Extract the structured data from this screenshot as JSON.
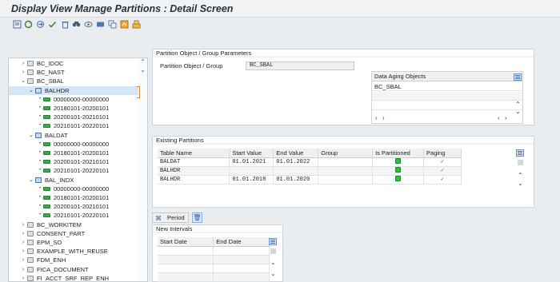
{
  "window": {
    "title": "Display View Manage Partitions : Detail Screen"
  },
  "toolbar": {
    "icons": [
      "display-object-icon",
      "refresh-icon",
      "transport-icon",
      "check-icon",
      "delete-icon",
      "find-icon",
      "display-icon",
      "info-icon",
      "copy-icon",
      "execute-icon",
      "org-icon"
    ]
  },
  "tree": {
    "items": [
      {
        "label": "BC_IDOC",
        "level": 1,
        "type": "node",
        "expanded": false
      },
      {
        "label": "BC_NAST",
        "level": 1,
        "type": "node",
        "expanded": false
      },
      {
        "label": "BC_SBAL",
        "level": 1,
        "type": "node",
        "expanded": true
      },
      {
        "label": "BALHDR",
        "level": 2,
        "type": "table",
        "expanded": true,
        "selected": true
      },
      {
        "label": "00000000-00000000",
        "level": 3,
        "type": "leaf"
      },
      {
        "label": "20180101-20200101",
        "level": 3,
        "type": "leaf"
      },
      {
        "label": "20200101-20210101",
        "level": 3,
        "type": "leaf"
      },
      {
        "label": "20210101-20220101",
        "level": 3,
        "type": "leaf"
      },
      {
        "label": "BALDAT",
        "level": 2,
        "type": "table",
        "expanded": true
      },
      {
        "label": "00000000-00000000",
        "level": 3,
        "type": "leaf"
      },
      {
        "label": "20180101-20200101",
        "level": 3,
        "type": "leaf"
      },
      {
        "label": "20200101-20210101",
        "level": 3,
        "type": "leaf"
      },
      {
        "label": "20210101-20220101",
        "level": 3,
        "type": "leaf"
      },
      {
        "label": "BAL_INDX",
        "level": 2,
        "type": "table",
        "expanded": true
      },
      {
        "label": "00000000-00000000",
        "level": 3,
        "type": "leaf"
      },
      {
        "label": "20180101-20200101",
        "level": 3,
        "type": "leaf"
      },
      {
        "label": "20200101-20210101",
        "level": 3,
        "type": "leaf"
      },
      {
        "label": "20210101-20220101",
        "level": 3,
        "type": "leaf"
      },
      {
        "label": "BC_WORKITEM",
        "level": 1,
        "type": "node",
        "expanded": false
      },
      {
        "label": "CONSENT_PART",
        "level": 1,
        "type": "node",
        "expanded": false
      },
      {
        "label": "EPM_SO",
        "level": 1,
        "type": "node",
        "expanded": false
      },
      {
        "label": "EXAMPLE_WITH_REUSE",
        "level": 1,
        "type": "node",
        "expanded": false
      },
      {
        "label": "FDM_ENH",
        "level": 1,
        "type": "node",
        "expanded": false
      },
      {
        "label": "FICA_DOCUMENT",
        "level": 1,
        "type": "node",
        "expanded": false
      },
      {
        "label": "FI_ACCT_SRF_REP_ENH",
        "level": 1,
        "type": "node",
        "expanded": false
      }
    ]
  },
  "params_panel": {
    "header": "Partition Object / Group Parameters",
    "field_label": "Partition Object / Group",
    "field_value": "BC_SBAL",
    "aging_table": {
      "header": "Data Aging Objects",
      "rows": [
        "BC_SBAL",
        "",
        ""
      ]
    }
  },
  "partitions_panel": {
    "header": "Existing Partitions",
    "columns": [
      "Table Name",
      "Start Value",
      "End Value",
      "Group",
      "Is Partitioned",
      "Paging"
    ],
    "rows": [
      {
        "table_name": "BALDAT",
        "start": "01.01.2021",
        "end": "01.01.2022",
        "group": "",
        "partitioned": true,
        "paging": true
      },
      {
        "table_name": "BALHDR",
        "start": "",
        "end": "",
        "group": "",
        "partitioned": true,
        "paging": true
      },
      {
        "table_name": "BALHDR",
        "start": "01.01.2018",
        "end": "01.01.2020",
        "group": "",
        "partitioned": true,
        "paging": true
      }
    ]
  },
  "intervals": {
    "period_button": "Period",
    "header": "New Intervals",
    "columns": [
      "Start Date",
      "End Date"
    ]
  },
  "colors": {
    "accent": "#2fbd3c",
    "selection": "#d6e6f4",
    "title": "#28323c"
  }
}
